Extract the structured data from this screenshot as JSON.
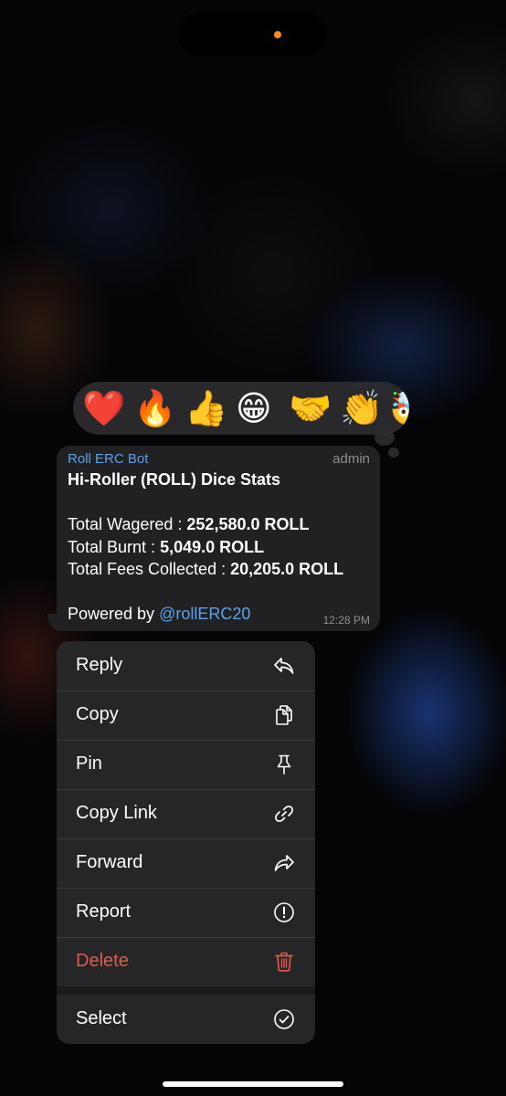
{
  "reactions": [
    "❤️",
    "🔥",
    "👍",
    "😁",
    "🤝",
    "👏",
    "🤯"
  ],
  "message": {
    "sender": "Roll ERC Bot",
    "role": "admin",
    "title": "Hi-Roller (ROLL) Dice Stats",
    "stats": [
      {
        "label": "Total Wagered : ",
        "value": "252,580.0 ROLL"
      },
      {
        "label": "Total Burnt : ",
        "value": "5,049.0 ROLL"
      },
      {
        "label": "Total Fees Collected : ",
        "value": "20,205.0 ROLL"
      }
    ],
    "powered_prefix": "Powered by ",
    "powered_link": "@rollERC20",
    "time": "12:28 PM"
  },
  "menu": {
    "items": [
      {
        "label": "Reply",
        "icon": "reply-icon"
      },
      {
        "label": "Copy",
        "icon": "copy-icon"
      },
      {
        "label": "Pin",
        "icon": "pin-icon"
      },
      {
        "label": "Copy Link",
        "icon": "link-icon"
      },
      {
        "label": "Forward",
        "icon": "forward-icon"
      },
      {
        "label": "Report",
        "icon": "report-icon"
      },
      {
        "label": "Delete",
        "icon": "trash-icon"
      }
    ],
    "select": {
      "label": "Select",
      "icon": "checkmark-circle-icon"
    }
  },
  "colors": {
    "accent": "#5aa3ea",
    "danger": "#e2594d",
    "status_dot": "#ff8a1f"
  }
}
